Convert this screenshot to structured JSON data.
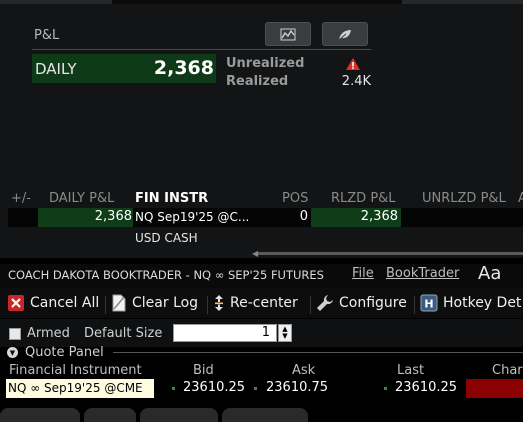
{
  "pnl": {
    "label": "P&L",
    "daily_label": "DAILY",
    "daily_value": "2,368",
    "unrealized_label": "Unrealized",
    "realized_label": "Realized",
    "realized_value": "2.4K",
    "icons": [
      "chart-icon",
      "leaf-icon",
      "warning-icon"
    ]
  },
  "positions": {
    "headers": [
      "+/-",
      "DAILY P&L",
      "FIN INSTR",
      "POS",
      "RLZD P&L",
      "UNRLZD P&L",
      "A"
    ],
    "rows": [
      {
        "daily": "2,368",
        "instr": "NQ Sep19'25 @C...",
        "pos": "0",
        "rlzd": "2,368"
      },
      {
        "daily": "",
        "instr": "USD CASH",
        "pos": "",
        "rlzd": ""
      }
    ]
  },
  "booktrader": {
    "title": "COACH DAKOTA BOOKTRADER - NQ ∞ SEP'25 FUTURES",
    "menu": {
      "file": "File",
      "booktrader": "BookTrader",
      "font": "Aa"
    },
    "toolbar": {
      "cancel_all": "Cancel All",
      "clear_log": "Clear Log",
      "recenter": "Re-center",
      "configure": "Configure",
      "hotkey": "Hotkey Det"
    },
    "armed_label": "Armed",
    "default_size_label": "Default Size",
    "default_size_value": "1",
    "quote_panel_label": "Quote Panel",
    "quote_headers": {
      "instr": "Financial Instrument",
      "bid": "Bid",
      "ask": "Ask",
      "last": "Last",
      "change": "Char"
    },
    "quote": {
      "instr": "NQ ∞ Sep19'25 @CME",
      "bid": "23610.25",
      "ask": "23610.75",
      "last": "23610.25"
    }
  },
  "colors": {
    "positive_bg": "#0f3a18",
    "negative_bg": "#8b0000",
    "instrument_bg": "#fffbe0"
  }
}
